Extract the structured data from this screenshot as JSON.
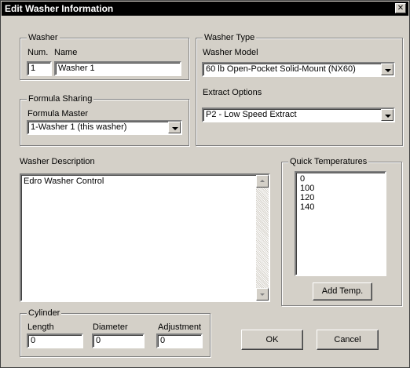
{
  "window": {
    "title": "Edit Washer Information",
    "close_glyph": "✕"
  },
  "washer": {
    "group_label": "Washer",
    "num_label": "Num.",
    "name_label": "Name",
    "num_value": "1",
    "name_value": "Washer 1"
  },
  "washer_type": {
    "group_label": "Washer Type",
    "model_label": "Washer Model",
    "model_value": "60 lb Open-Pocket Solid-Mount (NX60)",
    "extract_label": "Extract Options",
    "extract_value": "P2 - Low Speed Extract"
  },
  "formula_sharing": {
    "group_label": "Formula Sharing",
    "master_label": "Formula Master",
    "master_value": "1-Washer 1 (this washer)"
  },
  "description": {
    "label": "Washer Description",
    "value": "Edro Washer Control"
  },
  "quick_temps": {
    "group_label": "Quick Temperatures",
    "items": [
      "0",
      "100",
      "120",
      "140"
    ],
    "add_button": "Add Temp."
  },
  "cylinder": {
    "group_label": "Cylinder",
    "length_label": "Length",
    "diameter_label": "Diameter",
    "adjustment_label": "Adjustment",
    "length_value": "0",
    "diameter_value": "0",
    "adjustment_value": "0"
  },
  "buttons": {
    "ok": "OK",
    "cancel": "Cancel"
  }
}
